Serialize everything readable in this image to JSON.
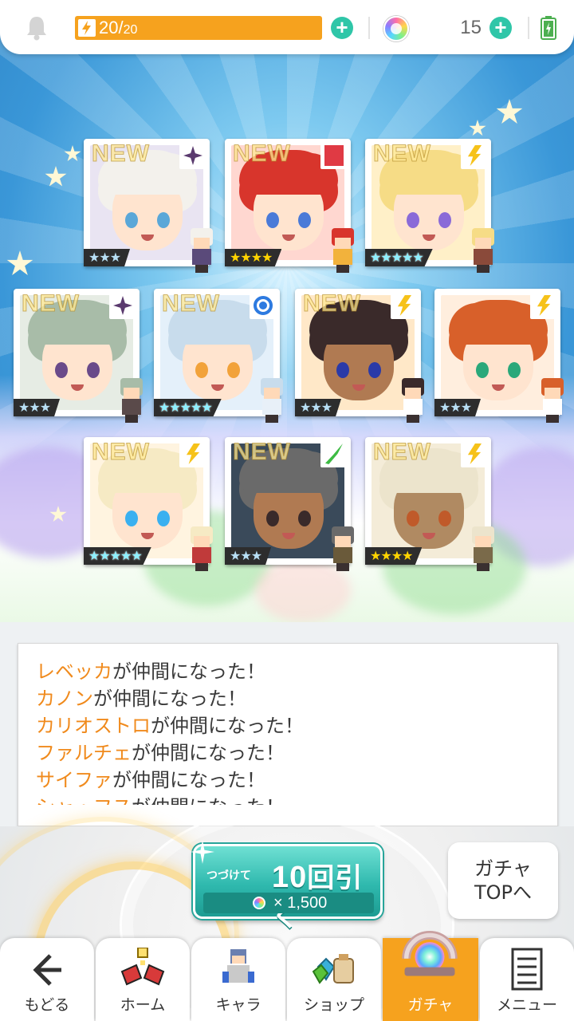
{
  "status_bar": {
    "stamina_current": "20",
    "stamina_sep": "/",
    "stamina_max": "20",
    "stamina_fill_percent": 100,
    "gem_count": "15",
    "icons": [
      "bell-icon",
      "lightning-icon",
      "plus-icon",
      "rainbow-gem-icon",
      "battery-icon"
    ]
  },
  "colors": {
    "accent_orange": "#f6a21e",
    "teal_button": "#2fc6a8",
    "name_orange": "#f08a1c",
    "sky_blue": "#3a97d8"
  },
  "gacha_results": [
    {
      "new_label": "NEW",
      "element": "dark",
      "rarity": "★★★",
      "stars": 3
    },
    {
      "new_label": "NEW",
      "element": "fire",
      "rarity": "★★★★",
      "stars": 4
    },
    {
      "new_label": "NEW",
      "element": "light",
      "rarity": "★★★★★",
      "stars": 5
    },
    {
      "new_label": "NEW",
      "element": "dark",
      "rarity": "★★★",
      "stars": 3
    },
    {
      "new_label": "NEW",
      "element": "water",
      "rarity": "★★★★★",
      "stars": 5
    },
    {
      "new_label": "NEW",
      "element": "light",
      "rarity": "★★★",
      "stars": 3
    },
    {
      "new_label": "",
      "element": "light",
      "rarity": "★★★",
      "stars": 3
    },
    {
      "new_label": "NEW",
      "element": "light",
      "rarity": "★★★★★",
      "stars": 5
    },
    {
      "new_label": "NEW",
      "element": "wind",
      "rarity": "★★★",
      "stars": 3
    },
    {
      "new_label": "NEW",
      "element": "light",
      "rarity": "★★★★",
      "stars": 4
    }
  ],
  "message_log": [
    {
      "name": "レベッカ",
      "suffix": "が仲間になった！"
    },
    {
      "name": "カノン",
      "suffix": "が仲間になった！"
    },
    {
      "name": "カリオストロ",
      "suffix": "が仲間になった！"
    },
    {
      "name": "ファルチェ",
      "suffix": "が仲間になった！"
    },
    {
      "name": "サイファ",
      "suffix": "が仲間になった！"
    },
    {
      "name": "シャ・フス",
      "suffix": "が仲間になった！"
    }
  ],
  "pull_button": {
    "prefix": "つづけて",
    "count": "10",
    "action": "回引く",
    "cost": "× 1,500"
  },
  "gacha_top_button": {
    "line1": "ガチャ",
    "line2": "TOPへ"
  },
  "nav": [
    {
      "label": "もどる",
      "icon": "back-arrow-icon"
    },
    {
      "label": "ホーム",
      "icon": "home-icon"
    },
    {
      "label": "キャラ",
      "icon": "character-icon"
    },
    {
      "label": "ショップ",
      "icon": "shop-icon"
    },
    {
      "label": "ガチャ",
      "icon": "gacha-icon",
      "active": true
    },
    {
      "label": "メニュー",
      "icon": "menu-icon"
    }
  ]
}
